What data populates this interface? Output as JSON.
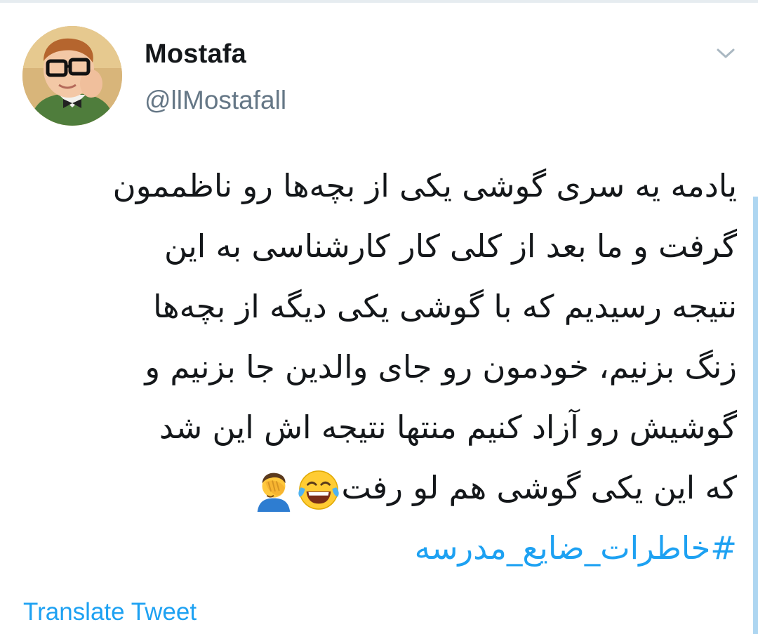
{
  "tweet": {
    "author": {
      "display_name": "Mostafa",
      "handle": "@llMostafall"
    },
    "text_lines": [
      "یادمه یه سری گوشی یکی از بچه‌ها رو ناظممون",
      "گرفت و ما بعد از کلی کار کارشناسی به این",
      "نتیجه رسیدیم که با گوشی یکی دیگه از بچه‌ها",
      "زنگ بزنیم، خودمون رو جای والدین جا بزنیم و",
      "گوشیش رو آزاد کنیم منتها نتیجه اش این شد",
      "که این یکی گوشی هم لو رفت"
    ],
    "emojis": [
      "face-with-tears-of-joy",
      "person-facepalming"
    ],
    "hashtag": "#خاطرات_ضایع_مدرسه",
    "translate_label": "Translate Tweet"
  },
  "colors": {
    "link": "#1da1f2",
    "secondary_text": "#657786",
    "primary_text": "#14171a"
  }
}
